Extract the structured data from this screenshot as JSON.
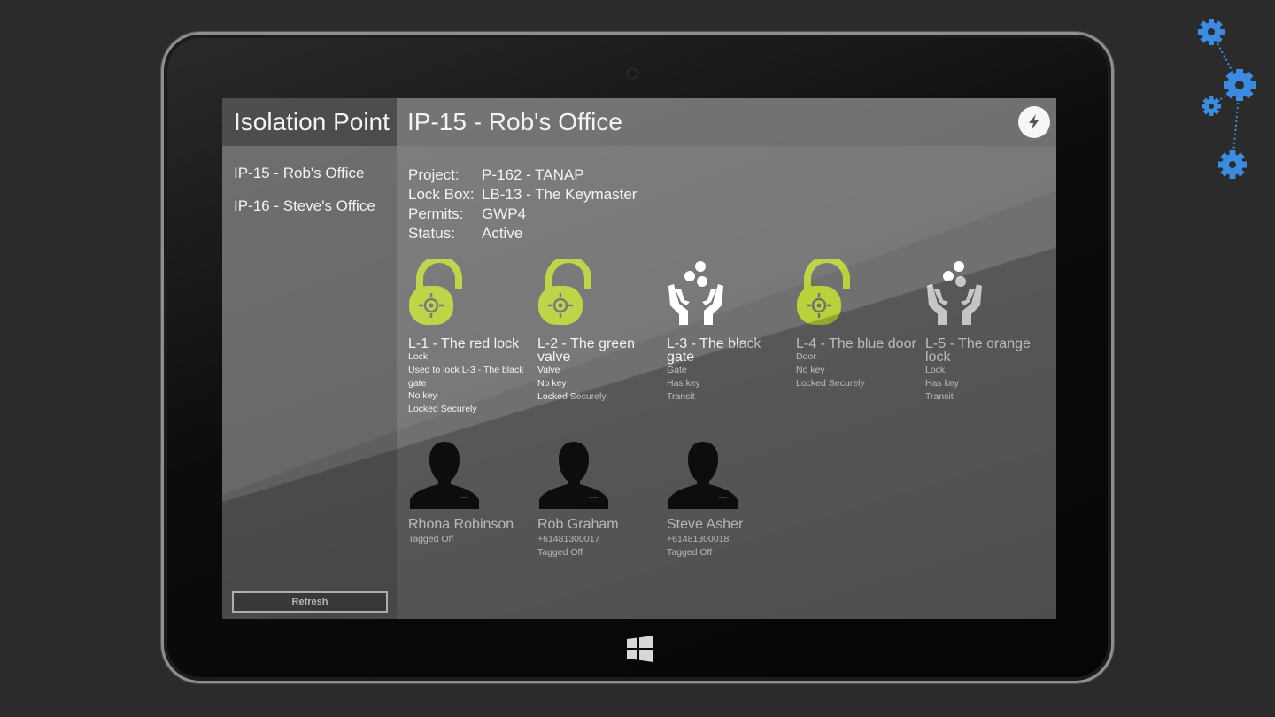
{
  "sidebar": {
    "title": "Isolation Point",
    "items": [
      {
        "label": "IP-15 - Rob's Office"
      },
      {
        "label": "IP-16 - Steve's Office"
      }
    ],
    "refresh_label": "Refresh"
  },
  "main": {
    "title": "IP-15 - Rob's Office",
    "action_icon": "lightning-icon",
    "details": [
      {
        "label": "Project:",
        "value": "P-162 - TANAP"
      },
      {
        "label": "Lock Box:",
        "value": "LB-13 - The Keymaster"
      },
      {
        "label": "Permits:",
        "value": "GWP4"
      },
      {
        "label": "Status:",
        "value": "Active"
      }
    ],
    "locks": [
      {
        "icon": "padlock-icon",
        "title": "L-1 - The red lock",
        "lines": [
          "Lock",
          "Used to lock L-3 - The black gate",
          "No key",
          "Locked Securely"
        ]
      },
      {
        "icon": "padlock-icon",
        "title": "L-2 - The green valve",
        "lines": [
          "Valve",
          "No key",
          "Locked Securely"
        ]
      },
      {
        "icon": "hands-keys-icon",
        "title": "L-3 - The black gate",
        "lines": [
          "Gate",
          "Has key",
          "Transit"
        ]
      },
      {
        "icon": "padlock-icon",
        "title": "L-4 - The blue door",
        "lines": [
          "Door",
          "No key",
          "Locked Securely"
        ]
      },
      {
        "icon": "hands-keys-icon",
        "title": "L-5 - The orange lock",
        "lines": [
          "Lock",
          "Has key",
          "Transit"
        ]
      }
    ],
    "people": [
      {
        "name": "Rhona Robinson",
        "lines": [
          "Tagged Off"
        ]
      },
      {
        "name": "Rob Graham",
        "lines": [
          "+61481300017",
          "Tagged Off"
        ]
      },
      {
        "name": "Steve Asher",
        "lines": [
          "+61481300018",
          "Tagged Off"
        ]
      }
    ]
  },
  "colors": {
    "lock_green": "#b9d23c",
    "gear_blue": "#3b8be0",
    "screen_bg": "#707070",
    "sidebar_bg": "#5f5f5f"
  }
}
